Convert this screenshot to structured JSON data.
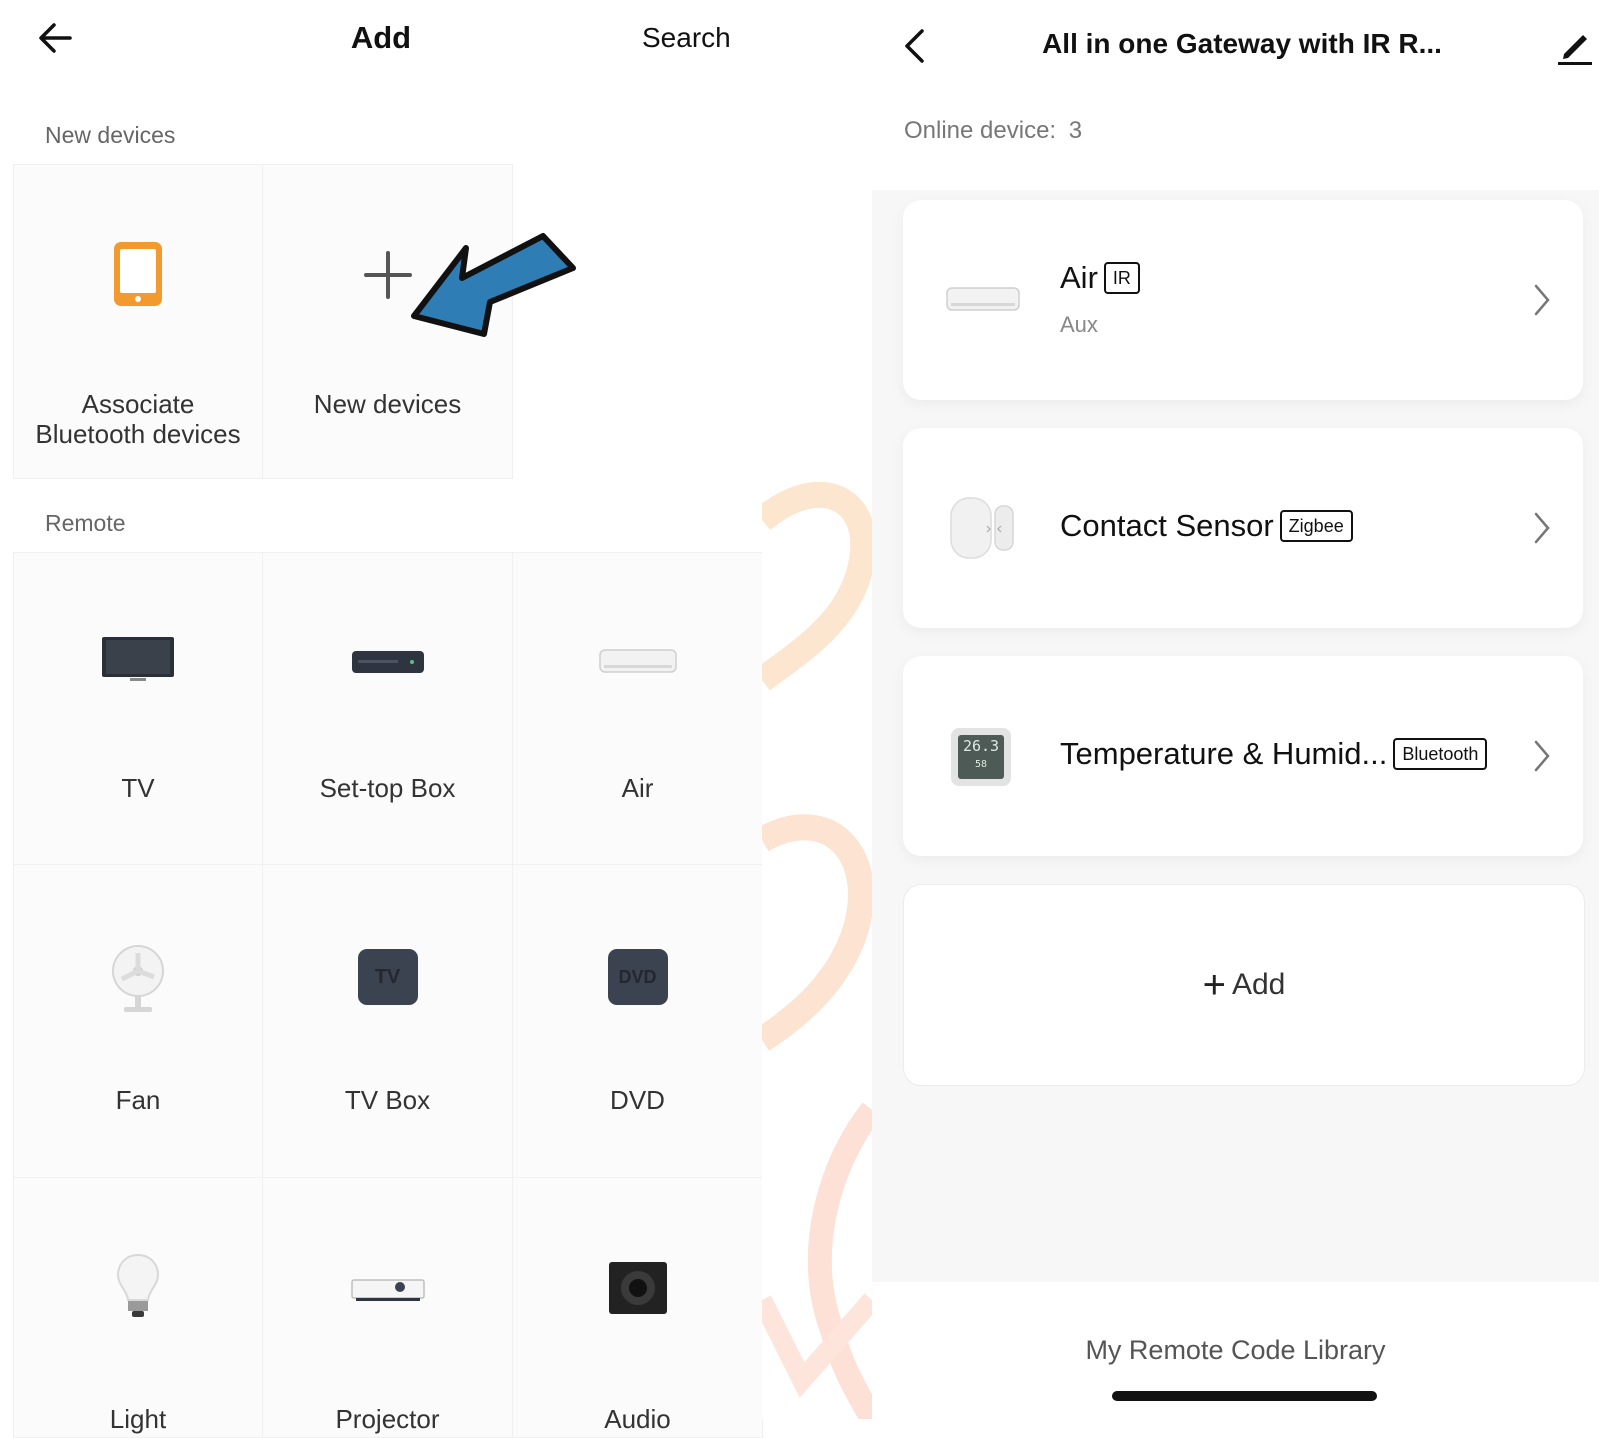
{
  "left": {
    "title": "Add",
    "search_label": "Search",
    "new_section_title": "New devices",
    "new_tiles": [
      {
        "label": "Associate Bluetooth devices",
        "icon": "phone-icon"
      },
      {
        "label": "New devices",
        "icon": "plus-icon"
      }
    ],
    "remote_section_title": "Remote",
    "remote_tiles": [
      {
        "label": "TV",
        "icon": "tv-icon"
      },
      {
        "label": "Set-top Box",
        "icon": "set-top-box-icon"
      },
      {
        "label": "Air",
        "icon": "air-conditioner-icon"
      },
      {
        "label": "Fan",
        "icon": "fan-icon"
      },
      {
        "label": "TV Box",
        "icon": "tv-box-icon",
        "icon_text": "TV"
      },
      {
        "label": "DVD",
        "icon": "dvd-icon",
        "icon_text": "DVD"
      },
      {
        "label": "Light",
        "icon": "light-bulb-icon"
      },
      {
        "label": "Projector",
        "icon": "projector-icon"
      },
      {
        "label": "Audio",
        "icon": "speaker-icon"
      }
    ]
  },
  "right": {
    "title": "All in one Gateway with IR R...",
    "online_label": "Online device:",
    "online_count": "3",
    "devices": [
      {
        "name": "Air",
        "badge": "IR",
        "subtitle": "Aux",
        "icon": "air-conditioner-icon"
      },
      {
        "name": "Contact Sensor",
        "badge": "Zigbee",
        "subtitle": "",
        "icon": "contact-sensor-icon"
      },
      {
        "name": "Temperature & Humid...",
        "badge": "Bluetooth",
        "subtitle": "",
        "icon": "thermometer-hygrometer-icon",
        "display_temp": "26.3",
        "display_humidity": "58"
      }
    ],
    "add_label": "Add",
    "library_label": "My Remote Code Library"
  },
  "colors": {
    "accent_orange": "#F39A2E",
    "arrow_blue": "#2E7DB5",
    "text_dark": "#111111",
    "text_muted": "#777777"
  }
}
